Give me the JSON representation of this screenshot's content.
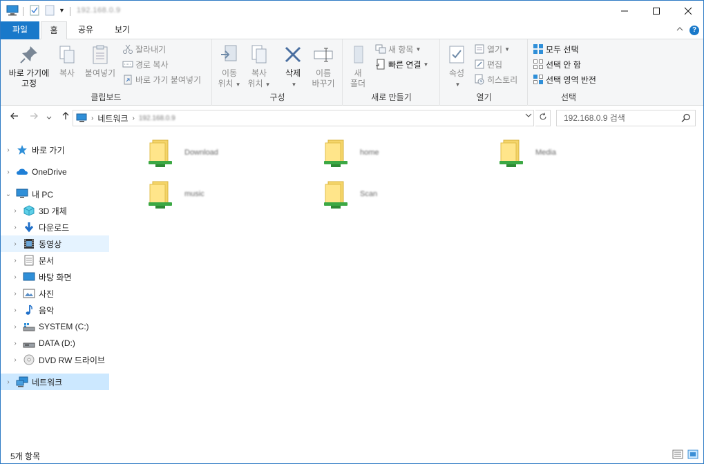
{
  "titlebar": {
    "title": "192.168.0.9"
  },
  "tabs": {
    "file": "파일",
    "home": "홈",
    "share": "공유",
    "view": "보기"
  },
  "ribbon": {
    "clipboard": {
      "label": "클립보드",
      "pin_line1": "바로 가기에",
      "pin_line2": "고정",
      "copy": "복사",
      "paste": "붙여넣기",
      "cut": "잘라내기",
      "copy_path": "경로 복사",
      "paste_shortcut": "바로 가기 붙여넣기"
    },
    "organize": {
      "label": "구성",
      "move_line1": "이동",
      "move_line2": "위치",
      "copyto_line1": "복사",
      "copyto_line2": "위치",
      "delete": "삭제",
      "rename_line1": "이름",
      "rename_line2": "바꾸기"
    },
    "new": {
      "label": "새로 만들기",
      "folder_line1": "새",
      "folder_line2": "폴더",
      "new_item": "새 항목",
      "easy_access": "빠른 연결"
    },
    "open": {
      "label": "열기",
      "properties": "속성",
      "open": "열기",
      "edit": "편집",
      "history": "히스토리"
    },
    "select": {
      "label": "선택",
      "select_all": "모두 선택",
      "select_none": "선택 안 함",
      "invert": "선택 영역 반전"
    }
  },
  "address": {
    "crumbs": [
      "네트워크",
      "192.168.0.9"
    ],
    "search_placeholder": "192.168.0.9 검색"
  },
  "sidebar": {
    "items": [
      {
        "label": "바로 가기",
        "icon": "star-icon"
      },
      {
        "label": "OneDrive",
        "icon": "cloud-icon"
      },
      {
        "label": "내 PC",
        "icon": "pc-icon"
      },
      {
        "label": "3D 개체",
        "icon": "cube-icon"
      },
      {
        "label": "다운로드",
        "icon": "download-icon"
      },
      {
        "label": "동영상",
        "icon": "video-icon"
      },
      {
        "label": "문서",
        "icon": "document-icon"
      },
      {
        "label": "바탕 화면",
        "icon": "desktop-icon"
      },
      {
        "label": "사진",
        "icon": "picture-icon"
      },
      {
        "label": "음악",
        "icon": "music-icon"
      },
      {
        "label": "SYSTEM (C:)",
        "icon": "drive-c-icon"
      },
      {
        "label": "DATA (D:)",
        "icon": "drive-d-icon"
      },
      {
        "label": "DVD RW 드라이브",
        "icon": "dvd-icon"
      },
      {
        "label": "네트워크",
        "icon": "network-icon"
      }
    ]
  },
  "content": {
    "folders": [
      {
        "name": "Download"
      },
      {
        "name": "home"
      },
      {
        "name": "Media"
      },
      {
        "name": "music"
      },
      {
        "name": "Scan"
      }
    ]
  },
  "status": {
    "item_count": "5개 항목"
  },
  "colors": {
    "accent": "#1979ca",
    "selected_bg": "#cce8ff",
    "hover_bg": "#e5f3ff",
    "folder_yellow": "#f5d56a",
    "share_green": "#3ca844"
  }
}
